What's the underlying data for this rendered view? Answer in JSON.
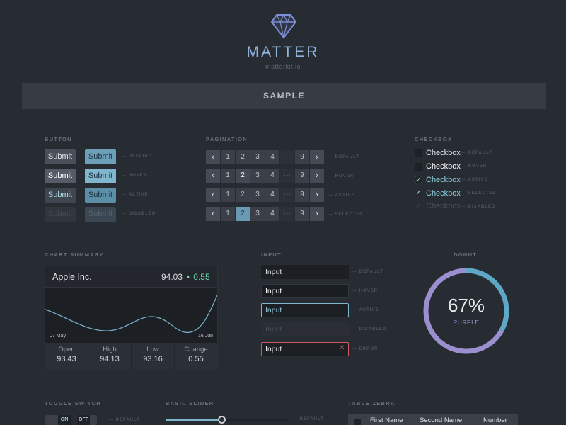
{
  "brand": {
    "name": "MATTER",
    "url": "matterkit.io"
  },
  "banner": {
    "label": "SAMPLE"
  },
  "sections": {
    "button": "BUTTON",
    "pagination": "PAGINATION",
    "checkbox": "CHECKBOX",
    "chart": "CHART SUMMARY",
    "input": "INPUT",
    "donut": "DONUT",
    "toggle": "TOGGLE SWITCH",
    "slider": "BASIC SLIDER",
    "table": "TABLE ZEBRA"
  },
  "states": {
    "default": "DEFAULT",
    "hover": "HOVER",
    "active": "ACTIVE",
    "disabled": "DISABLED",
    "selected": "SELECTED",
    "error": "ERROR"
  },
  "button": {
    "label": "Submit"
  },
  "pagination": {
    "prev": "‹",
    "next": "›",
    "pages": [
      "1",
      "2",
      "3",
      "4"
    ],
    "ellipsis": "···",
    "last": "9"
  },
  "checkbox": {
    "label": "Checkbox"
  },
  "chart": {
    "company": "Apple Inc.",
    "price": "94.03",
    "change": "0.55",
    "change_arrow": "▲",
    "start_date": "07 May",
    "end_date": "16 Jun",
    "stats": [
      {
        "label": "Open",
        "value": "93.43"
      },
      {
        "label": "High",
        "value": "94.13"
      },
      {
        "label": "Low",
        "value": "93.16"
      },
      {
        "label": "Change",
        "value": "0.55"
      }
    ]
  },
  "input": {
    "value": "Input",
    "error_icon": "✕"
  },
  "donut": {
    "percent": "67%",
    "label": "PURPLE",
    "value": 0.67,
    "color_main": "#9b8fd0",
    "color_accent": "#5fa7c6"
  },
  "toggle": {
    "on": "ON",
    "off": "OFF"
  },
  "slider": {
    "value": 0.46
  },
  "table": {
    "columns": [
      "First Name",
      "Second Name",
      "Number"
    ]
  }
}
